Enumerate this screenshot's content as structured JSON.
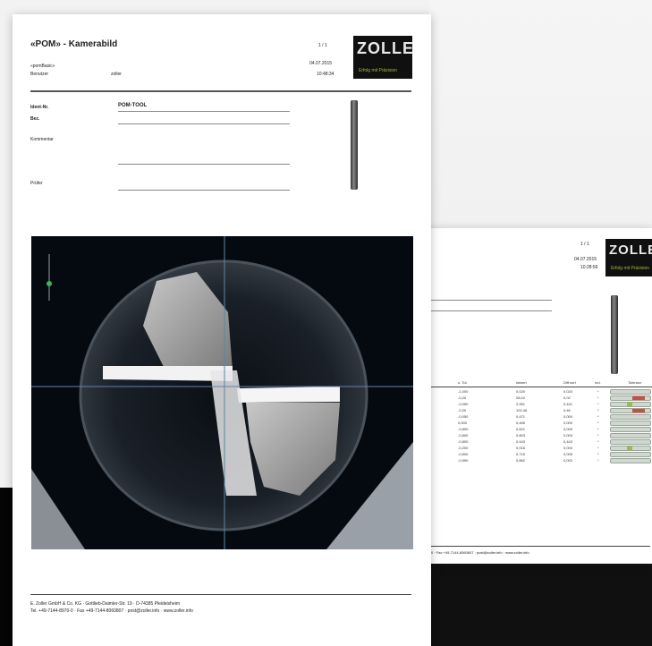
{
  "front": {
    "title": "«POM» - Kamerabild",
    "page_no": "1 / 1",
    "subtitle": "«pomBasic»",
    "user_label": "Benutzer",
    "user_value": "zoller",
    "date": "04.07.2015",
    "time": "10:48:34",
    "logo_text": "ZOLLER",
    "logo_tagline": "Erfolg mit Präzision",
    "fields": [
      {
        "label": "Ident-Nr.",
        "value": "POM-TOOL"
      },
      {
        "label": "Bez.",
        "value": ""
      },
      {
        "label": "Kommentar",
        "value": ""
      },
      {
        "label": "Prüfer",
        "value": ""
      }
    ],
    "footer_line1": "E. Zoller GmbH & Co. KG · Gottlieb-Daimler-Str. 19 · D-74385 Pleidelsheim",
    "footer_line2": "Tel. +49-7144-8970-0 · Fax +49-7144-8060807 · post@zoller.info · www.zoller.info"
  },
  "back": {
    "page_no": "1 / 1",
    "date": "04.07.2015",
    "time": "10:28:56",
    "logo_text": "ZOLLER",
    "logo_tagline": "Erfolg mit Präzision",
    "table_headers": [
      "u. Tol.",
      "Istwert",
      "Diff.sort",
      "Ind.",
      "Toleranz"
    ],
    "rows": [
      {
        "utol": "-1,000",
        "ist": "0,020",
        "diff": "0,020",
        "ind": "*",
        "status": "ok"
      },
      {
        "utol": "-0,20",
        "ist": "28,02",
        "diff": "0,02",
        "ind": "*",
        "status": "bad"
      },
      {
        "utol": "-0,050",
        "ist": "2,951",
        "diff": "0,441",
        "ind": "*",
        "status": "warn"
      },
      {
        "utol": "-0,20",
        "ist": "102,46",
        "diff": "0,46",
        "ind": "*",
        "status": "bad"
      },
      {
        "utol": "-0,050",
        "ist": "0,471",
        "diff": "0,000",
        "ind": "*",
        "status": "ok"
      },
      {
        "utol": "0,000",
        "ist": "0,465",
        "diff": "0,000",
        "ind": "*",
        "status": "ok"
      },
      {
        "utol": "-0,800",
        "ist": "0,621",
        "diff": "0,000",
        "ind": "*",
        "status": "ok"
      },
      {
        "utol": "-0,800",
        "ist": "0,803",
        "diff": "0,003",
        "ind": "*",
        "status": "ok"
      },
      {
        "utol": "-0,800",
        "ist": "0,443",
        "diff": "0,443",
        "ind": "*",
        "status": "ok"
      },
      {
        "utol": "-0,200",
        "ist": "0,016",
        "diff": "0,000",
        "ind": "*",
        "status": "warn"
      },
      {
        "utol": "-0,800",
        "ist": "0,715",
        "diff": "0,005",
        "ind": "*",
        "status": "ok"
      },
      {
        "utol": "-0,990",
        "ist": "0,862",
        "diff": "0,002",
        "ind": "*",
        "status": "ok"
      }
    ],
    "footer": "0 · Fax +49-7144-8060807 · post@zoller.info · www.zoller.info"
  },
  "colors": {
    "logo_bg": "#101010",
    "tagline": "#9fc02c",
    "tol_ok": "#cfd8cf",
    "tol_bad": "#d24b3c",
    "tol_warn": "#9fc02c",
    "crosshair": "#5a86a8",
    "slider_dot": "#2fbf4f"
  },
  "icons": [
    "drill-tool-image",
    "camera-crosshair",
    "focus-slider"
  ]
}
